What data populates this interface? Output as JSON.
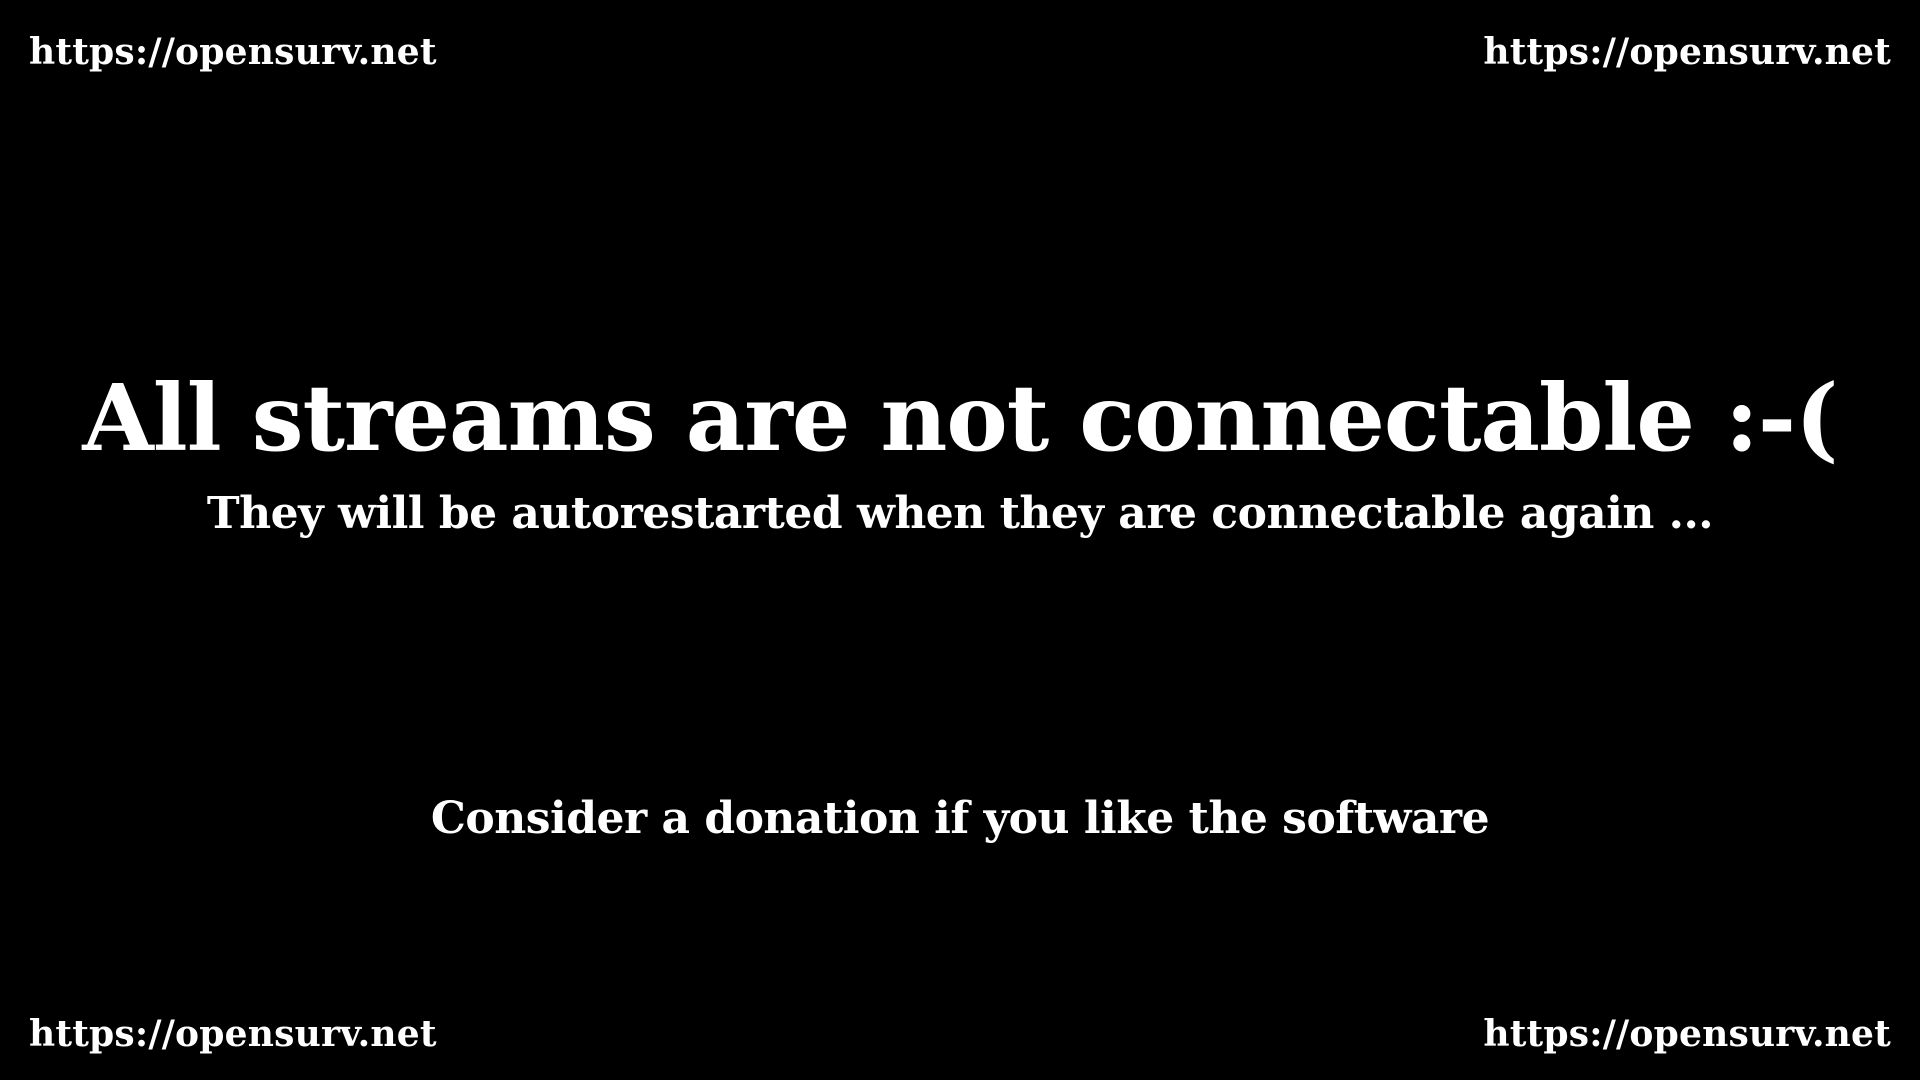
{
  "corners": {
    "top_left": "https://opensurv.net",
    "top_right": "https://opensurv.net",
    "bottom_left": "https://opensurv.net",
    "bottom_right": "https://opensurv.net"
  },
  "message": {
    "title": "All streams are not connectable :-(",
    "subtitle": "They will be autorestarted when they are connectable again ...",
    "donation": "Consider a donation if you like the software"
  },
  "colors": {
    "background": "#000000",
    "text": "#ffffff"
  }
}
